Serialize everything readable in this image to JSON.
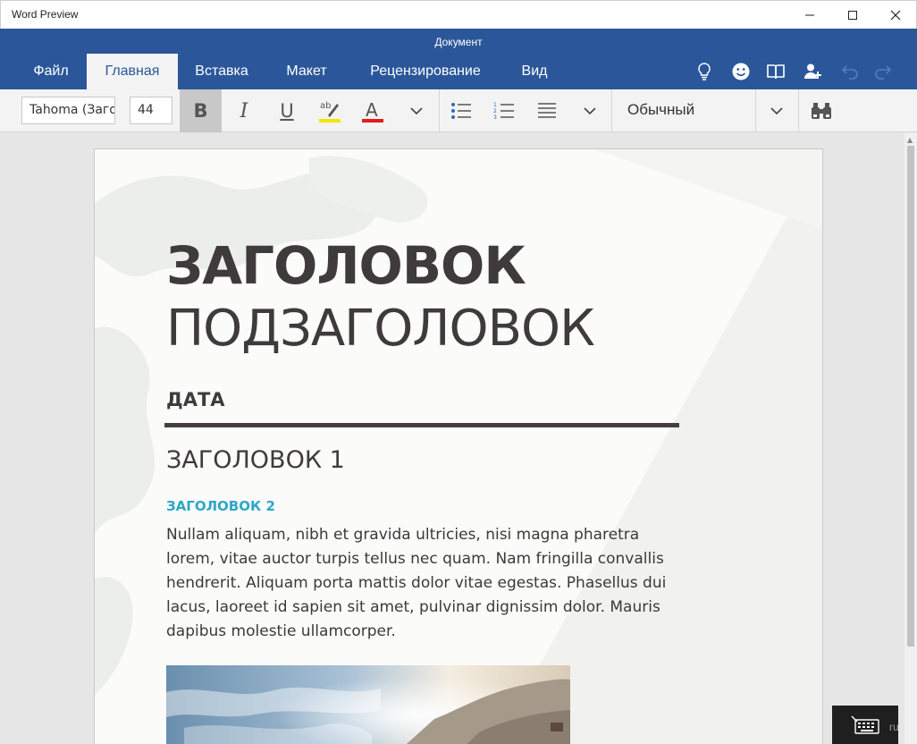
{
  "window": {
    "app_title": "Word Preview",
    "document_title": "Документ"
  },
  "tabs": [
    {
      "label": "Файл"
    },
    {
      "label": "Главная"
    },
    {
      "label": "Вставка"
    },
    {
      "label": "Макет"
    },
    {
      "label": "Рецензирование"
    },
    {
      "label": "Вид"
    }
  ],
  "active_tab": "Главная",
  "header_icons": [
    "lightbulb-icon",
    "smiley-icon",
    "book-icon",
    "add-person-icon",
    "undo-icon",
    "redo-icon"
  ],
  "ribbon": {
    "font_name": "Tahoma (Заголовки)",
    "font_size": "44",
    "bold_active": true,
    "style_name": "Обычный",
    "highlight_color": "#f2e600",
    "font_color": "#e01e1e"
  },
  "document": {
    "title": "ЗАГОЛОВОК",
    "subtitle": "ПОДЗАГОЛОВОК",
    "date": "ДАТА",
    "heading1": "ЗАГОЛОВОК 1",
    "heading2": "ЗАГОЛОВОК 2",
    "body": "Nullam aliquam, nibh et gravida ultricies, nisi magna pharetra lorem, vitae auctor turpis tellus nec quam. Nam fringilla convallis hendrerit. Aliquam porta mattis dolor vitae egestas. Phasellus dui lacus, laoreet id sapien sit amet, pulvinar dignissim dolor. Mauris dapibus molestie ullamcorper."
  },
  "watermark": "ru",
  "colors": {
    "accent": "#2b579a",
    "heading2": "#2fa6c8",
    "text_dark": "#3f3b3d"
  }
}
